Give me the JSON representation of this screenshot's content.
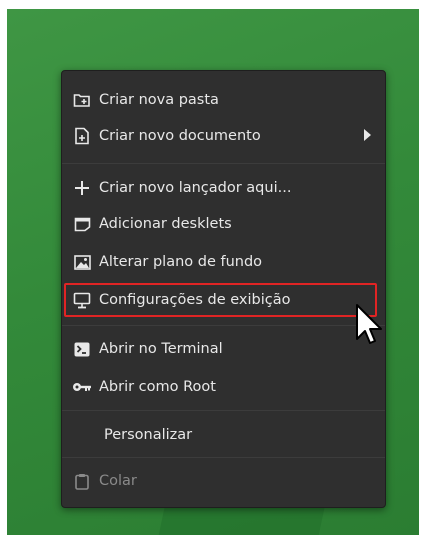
{
  "menu": {
    "items": [
      {
        "label": "Criar nova pasta",
        "icon": "new-folder-icon"
      },
      {
        "label": "Criar novo documento",
        "icon": "new-document-icon",
        "submenu": true
      },
      {
        "label": "Criar novo lançador aqui...",
        "icon": "plus-icon"
      },
      {
        "label": "Adicionar desklets",
        "icon": "desklet-icon"
      },
      {
        "label": "Alterar plano de fundo",
        "icon": "wallpaper-icon"
      },
      {
        "label": "Configurações de exibição",
        "icon": "display-icon",
        "highlighted": true
      },
      {
        "label": "Abrir no Terminal",
        "icon": "terminal-icon"
      },
      {
        "label": "Abrir como Root",
        "icon": "key-icon"
      },
      {
        "label": "Personalizar",
        "icon": ""
      },
      {
        "label": "Colar",
        "icon": "clipboard-icon",
        "disabled": true
      }
    ]
  },
  "colors": {
    "desktop_green": "#338a3a",
    "menu_bg": "#2f2f2f",
    "highlight_border": "#e02424",
    "text": "#e8e8e8",
    "disabled_text": "#8a8a8a"
  }
}
